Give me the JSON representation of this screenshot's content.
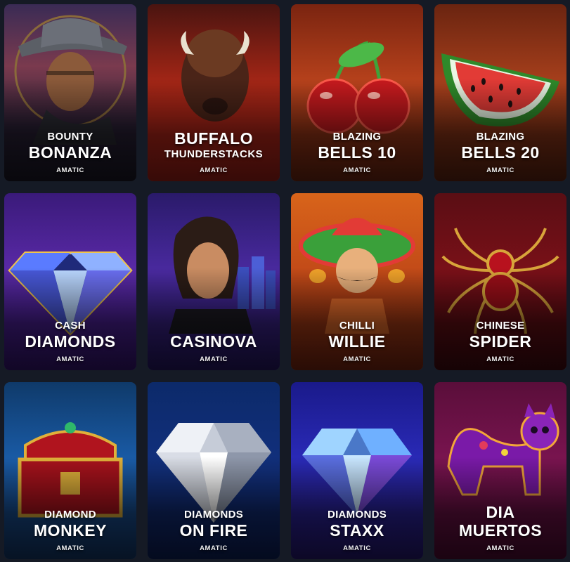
{
  "games": [
    {
      "line1": "BOUNTY",
      "line2": "BONANZA",
      "provider": "AMATIC"
    },
    {
      "line1": "BUFFALO",
      "line2": "THUNDERSTACKS",
      "provider": "AMATIC"
    },
    {
      "line1": "BLAZING",
      "line2": "BELLS 10",
      "provider": "AMATIC"
    },
    {
      "line1": "BLAZING",
      "line2": "BELLS 20",
      "provider": "AMATIC"
    },
    {
      "line1": "CASH",
      "line2": "DIAMONDS",
      "provider": "AMATIC"
    },
    {
      "line1": "",
      "line2": "CASINOVA",
      "provider": "AMATIC"
    },
    {
      "line1": "CHILLI",
      "line2": "WILLIE",
      "provider": "AMATIC"
    },
    {
      "line1": "CHINESE",
      "line2": "SPIDER",
      "provider": "AMATIC"
    },
    {
      "line1": "DIAMOND",
      "line2": "MONKEY",
      "provider": "AMATIC"
    },
    {
      "line1": "DIAMONDS",
      "line2": "ON FIRE",
      "provider": "AMATIC"
    },
    {
      "line1": "DIAMONDS",
      "line2": "STAXX",
      "provider": "AMATIC"
    },
    {
      "line1": "DIA",
      "line2": "MUERTOS",
      "provider": "AMATIC"
    }
  ]
}
